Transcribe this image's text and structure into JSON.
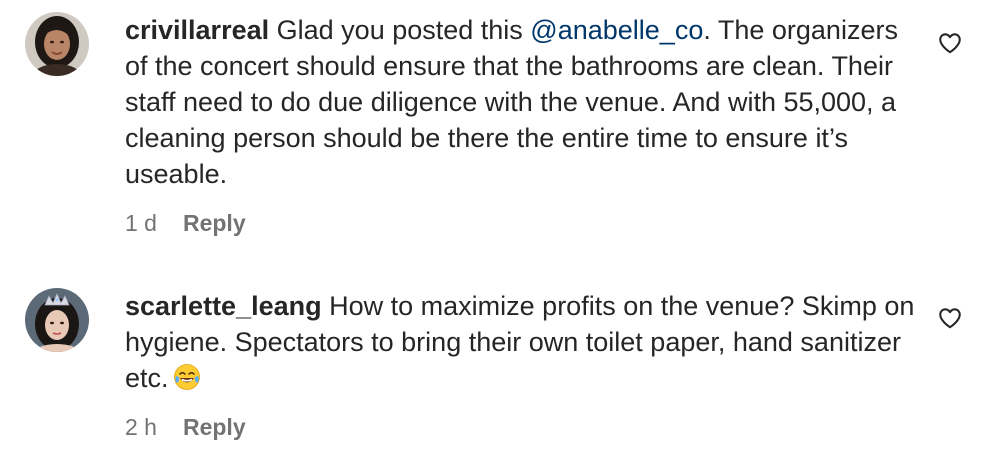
{
  "comments": [
    {
      "username": "crivillarreal",
      "text_before_mention": "Glad you posted this ",
      "mention": "@anabelle_co",
      "text_after_mention": ". The organizers of the concert should ensure that the bathrooms are clean. Their staff need to do due diligence with the venue. And with 55,000, a cleaning person should be there the entire time to ensure it’s useable.",
      "time": "1 d",
      "reply_label": "Reply",
      "avatar_icon": "profile-photo-woman-dark-hair",
      "like_icon": "heart-outline-icon"
    },
    {
      "username": "scarlette_leang",
      "text": "How to maximize profits on the venue? Skimp on hygiene. Spectators to bring their own toilet paper, hand sanitizer etc.",
      "emoji_icon": "face-with-tears-of-joy-emoji",
      "time": "2 h",
      "reply_label": "Reply",
      "avatar_icon": "profile-photo-woman-with-crown",
      "like_icon": "heart-outline-icon"
    }
  ],
  "colors": {
    "text": "#262626",
    "secondary": "#737373",
    "mention": "#00376b",
    "background": "#ffffff"
  }
}
